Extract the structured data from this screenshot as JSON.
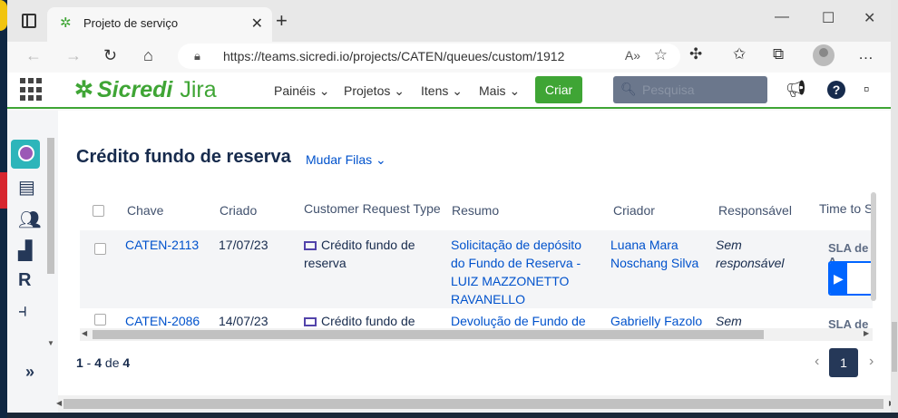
{
  "browser": {
    "tab_title": "Projeto de serviço",
    "url": "https://teams.sicredi.io/projects/CATEN/queues/custom/1912",
    "new_tab": "+",
    "tab_close": "✕"
  },
  "header": {
    "brand": "Sicredi",
    "product": "Jira",
    "menu": [
      {
        "label": "Painéis"
      },
      {
        "label": "Projetos"
      },
      {
        "label": "Itens"
      },
      {
        "label": "Mais"
      }
    ],
    "create_label": "Criar",
    "search_placeholder": "Pesquisa"
  },
  "main": {
    "title": "Crédito fundo de reserva",
    "switch_queue": "Mudar Filas",
    "columns": [
      "Chave",
      "Criado",
      "Customer Request Type",
      "Resumo",
      "Criador",
      "Responsável",
      "Time to SLA"
    ],
    "rows": [
      {
        "key": "CATEN-2113",
        "created": "17/07/23",
        "request_type_line1": "Crédito fundo de",
        "request_type_line2": "reserva",
        "summary": [
          "Solicitação de depósito",
          "do Fundo de Reserva -",
          "LUIZ MAZZONETTO",
          "RAVANELLO"
        ],
        "creator": [
          "Luana Mara",
          "Noschang Silva"
        ],
        "assignee": [
          "Sem",
          "responsável"
        ],
        "sla_label": "SLA de A",
        "sla_progress": 0.42
      },
      {
        "key": "CATEN-2086",
        "created": "14/07/23",
        "request_type_line1": "Crédito fundo de",
        "summary": [
          "Devolução de Fundo de"
        ],
        "creator": [
          "Gabrielly Fazolo"
        ],
        "assignee": [
          "Sem"
        ],
        "sla_label": "SLA de A"
      }
    ],
    "pagination": {
      "from": "1",
      "to": "4",
      "sep": " - ",
      "of_word": " de ",
      "total": "4",
      "current_page": "1"
    }
  }
}
